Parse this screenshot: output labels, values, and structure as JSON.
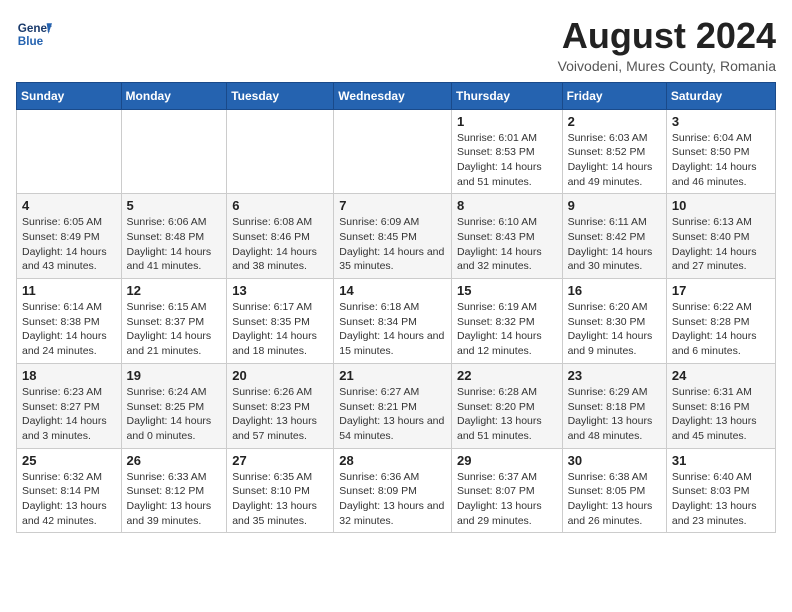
{
  "header": {
    "logo_line1": "General",
    "logo_line2": "Blue",
    "month_title": "August 2024",
    "subtitle": "Voivodeni, Mures County, Romania"
  },
  "days_of_week": [
    "Sunday",
    "Monday",
    "Tuesday",
    "Wednesday",
    "Thursday",
    "Friday",
    "Saturday"
  ],
  "weeks": [
    [
      {
        "num": "",
        "info": ""
      },
      {
        "num": "",
        "info": ""
      },
      {
        "num": "",
        "info": ""
      },
      {
        "num": "",
        "info": ""
      },
      {
        "num": "1",
        "info": "Sunrise: 6:01 AM\nSunset: 8:53 PM\nDaylight: 14 hours and 51 minutes."
      },
      {
        "num": "2",
        "info": "Sunrise: 6:03 AM\nSunset: 8:52 PM\nDaylight: 14 hours and 49 minutes."
      },
      {
        "num": "3",
        "info": "Sunrise: 6:04 AM\nSunset: 8:50 PM\nDaylight: 14 hours and 46 minutes."
      }
    ],
    [
      {
        "num": "4",
        "info": "Sunrise: 6:05 AM\nSunset: 8:49 PM\nDaylight: 14 hours and 43 minutes."
      },
      {
        "num": "5",
        "info": "Sunrise: 6:06 AM\nSunset: 8:48 PM\nDaylight: 14 hours and 41 minutes."
      },
      {
        "num": "6",
        "info": "Sunrise: 6:08 AM\nSunset: 8:46 PM\nDaylight: 14 hours and 38 minutes."
      },
      {
        "num": "7",
        "info": "Sunrise: 6:09 AM\nSunset: 8:45 PM\nDaylight: 14 hours and 35 minutes."
      },
      {
        "num": "8",
        "info": "Sunrise: 6:10 AM\nSunset: 8:43 PM\nDaylight: 14 hours and 32 minutes."
      },
      {
        "num": "9",
        "info": "Sunrise: 6:11 AM\nSunset: 8:42 PM\nDaylight: 14 hours and 30 minutes."
      },
      {
        "num": "10",
        "info": "Sunrise: 6:13 AM\nSunset: 8:40 PM\nDaylight: 14 hours and 27 minutes."
      }
    ],
    [
      {
        "num": "11",
        "info": "Sunrise: 6:14 AM\nSunset: 8:38 PM\nDaylight: 14 hours and 24 minutes."
      },
      {
        "num": "12",
        "info": "Sunrise: 6:15 AM\nSunset: 8:37 PM\nDaylight: 14 hours and 21 minutes."
      },
      {
        "num": "13",
        "info": "Sunrise: 6:17 AM\nSunset: 8:35 PM\nDaylight: 14 hours and 18 minutes."
      },
      {
        "num": "14",
        "info": "Sunrise: 6:18 AM\nSunset: 8:34 PM\nDaylight: 14 hours and 15 minutes."
      },
      {
        "num": "15",
        "info": "Sunrise: 6:19 AM\nSunset: 8:32 PM\nDaylight: 14 hours and 12 minutes."
      },
      {
        "num": "16",
        "info": "Sunrise: 6:20 AM\nSunset: 8:30 PM\nDaylight: 14 hours and 9 minutes."
      },
      {
        "num": "17",
        "info": "Sunrise: 6:22 AM\nSunset: 8:28 PM\nDaylight: 14 hours and 6 minutes."
      }
    ],
    [
      {
        "num": "18",
        "info": "Sunrise: 6:23 AM\nSunset: 8:27 PM\nDaylight: 14 hours and 3 minutes."
      },
      {
        "num": "19",
        "info": "Sunrise: 6:24 AM\nSunset: 8:25 PM\nDaylight: 14 hours and 0 minutes."
      },
      {
        "num": "20",
        "info": "Sunrise: 6:26 AM\nSunset: 8:23 PM\nDaylight: 13 hours and 57 minutes."
      },
      {
        "num": "21",
        "info": "Sunrise: 6:27 AM\nSunset: 8:21 PM\nDaylight: 13 hours and 54 minutes."
      },
      {
        "num": "22",
        "info": "Sunrise: 6:28 AM\nSunset: 8:20 PM\nDaylight: 13 hours and 51 minutes."
      },
      {
        "num": "23",
        "info": "Sunrise: 6:29 AM\nSunset: 8:18 PM\nDaylight: 13 hours and 48 minutes."
      },
      {
        "num": "24",
        "info": "Sunrise: 6:31 AM\nSunset: 8:16 PM\nDaylight: 13 hours and 45 minutes."
      }
    ],
    [
      {
        "num": "25",
        "info": "Sunrise: 6:32 AM\nSunset: 8:14 PM\nDaylight: 13 hours and 42 minutes."
      },
      {
        "num": "26",
        "info": "Sunrise: 6:33 AM\nSunset: 8:12 PM\nDaylight: 13 hours and 39 minutes."
      },
      {
        "num": "27",
        "info": "Sunrise: 6:35 AM\nSunset: 8:10 PM\nDaylight: 13 hours and 35 minutes."
      },
      {
        "num": "28",
        "info": "Sunrise: 6:36 AM\nSunset: 8:09 PM\nDaylight: 13 hours and 32 minutes."
      },
      {
        "num": "29",
        "info": "Sunrise: 6:37 AM\nSunset: 8:07 PM\nDaylight: 13 hours and 29 minutes."
      },
      {
        "num": "30",
        "info": "Sunrise: 6:38 AM\nSunset: 8:05 PM\nDaylight: 13 hours and 26 minutes."
      },
      {
        "num": "31",
        "info": "Sunrise: 6:40 AM\nSunset: 8:03 PM\nDaylight: 13 hours and 23 minutes."
      }
    ]
  ]
}
